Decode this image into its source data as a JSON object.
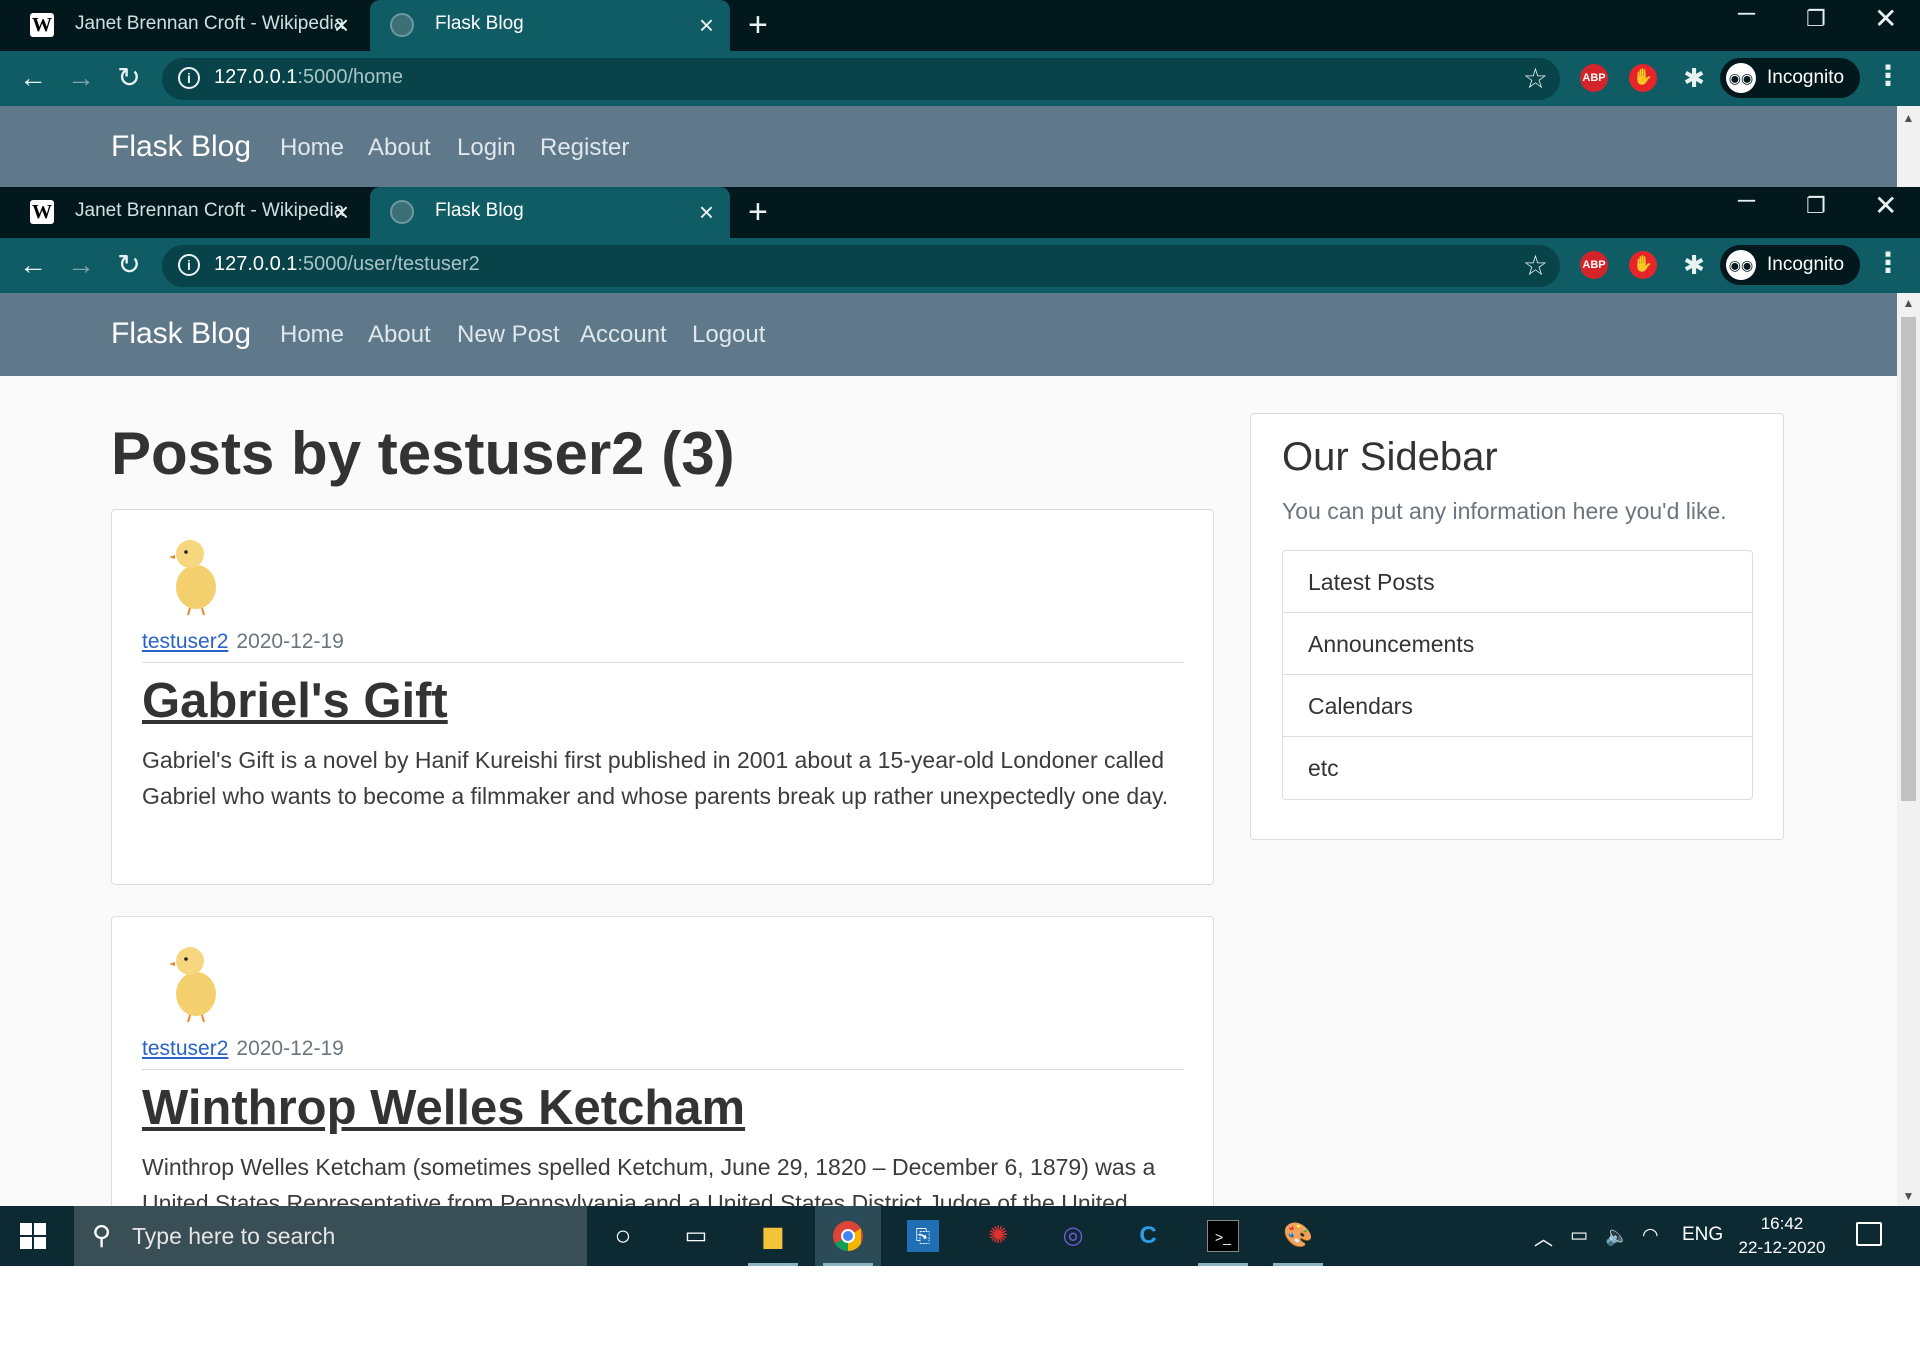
{
  "windows": [
    {
      "tabs": [
        {
          "label": "Janet Brennan Croft - Wikipedia",
          "favicon": "wikipedia-icon",
          "active": false
        },
        {
          "label": "Flask Blog",
          "favicon": "globe-icon",
          "active": true
        }
      ],
      "url_host": "127.0.0.1",
      "url_path": ":5000/home",
      "incognito_label": "Incognito",
      "navbar": {
        "brand": "Flask Blog",
        "links": [
          "Home",
          "About",
          "Login",
          "Register"
        ]
      }
    },
    {
      "tabs": [
        {
          "label": "Janet Brennan Croft - Wikipedia",
          "favicon": "wikipedia-icon",
          "active": false
        },
        {
          "label": "Flask Blog",
          "favicon": "globe-icon",
          "active": true
        }
      ],
      "url_host": "127.0.0.1",
      "url_path": ":5000/user/testuser2",
      "incognito_label": "Incognito",
      "navbar": {
        "brand": "Flask Blog",
        "links": [
          "Home",
          "About",
          "New Post",
          "Account",
          "Logout"
        ]
      }
    }
  ],
  "extensions": {
    "abp": "ABP"
  },
  "page": {
    "title": "Posts by testuser2 (3)",
    "posts": [
      {
        "author": "testuser2",
        "date": "2020-12-19",
        "title": "Gabriel's Gift",
        "body": "Gabriel's Gift is a novel by Hanif Kureishi first published in 2001 about a 15-year-old Londoner called Gabriel who wants to become a filmmaker and whose parents break up rather unexpectedly one day."
      },
      {
        "author": "testuser2",
        "date": "2020-12-19",
        "title": "Winthrop Welles Ketcham",
        "body": "Winthrop Welles Ketcham (sometimes spelled Ketchum, June 29, 1820 – December 6, 1879) was a United States Representative from Pennsylvania and a United States District Judge of the United"
      }
    ],
    "sidebar": {
      "heading": "Our Sidebar",
      "text": "You can put any information here you'd like.",
      "items": [
        "Latest Posts",
        "Announcements",
        "Calendars",
        "etc"
      ]
    }
  },
  "taskbar": {
    "search_placeholder": "Type here to search",
    "apps": [
      "cortana-icon",
      "task-view-icon",
      "file-explorer-icon",
      "chrome-icon",
      "remote-desktop-icon",
      "antivirus-icon",
      "app-icon",
      "ccleaner-icon",
      "terminal-icon",
      "paint-icon"
    ],
    "language": "ENG",
    "time": "16:42",
    "date": "22-12-2020"
  },
  "colors": {
    "tab_strip": "#03181c",
    "toolbar": "#0f5c64",
    "navbar": "#5f788a",
    "link": "#2962c8",
    "taskbar": "#0d2a33"
  }
}
